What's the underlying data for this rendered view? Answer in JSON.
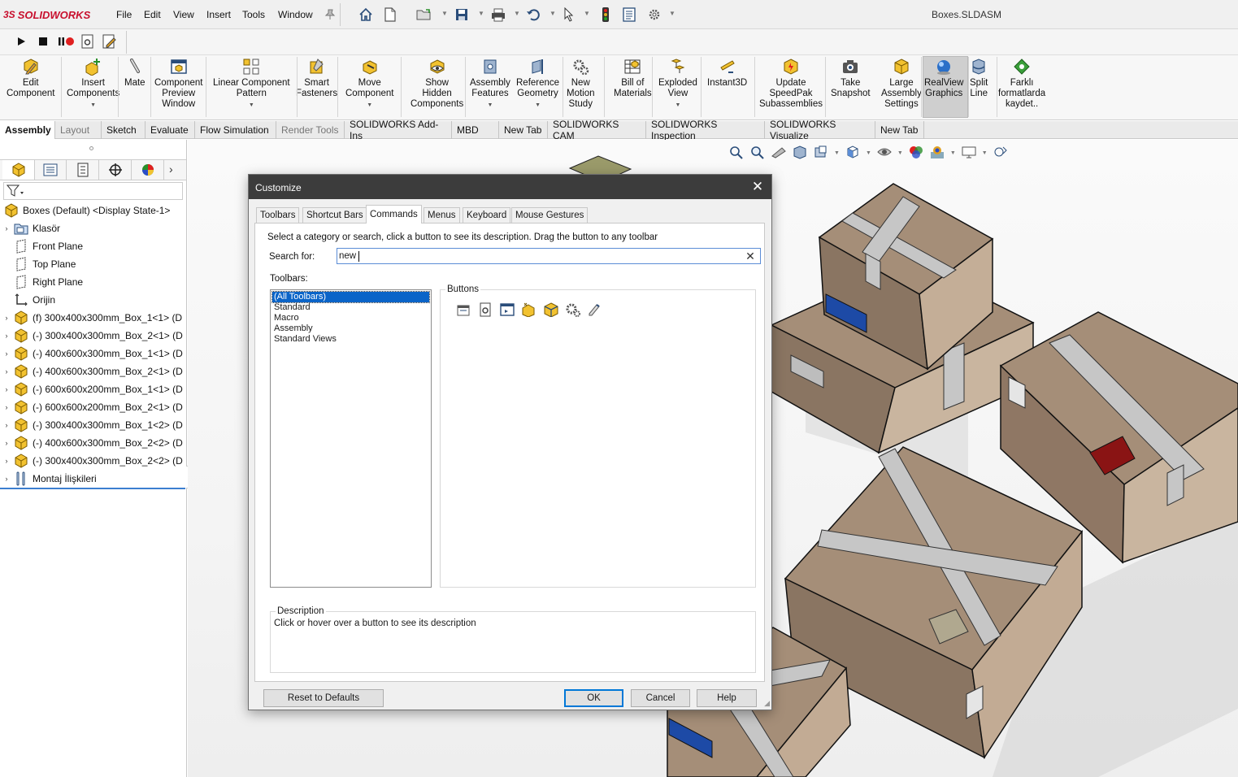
{
  "app": {
    "brand_prefix": "3S",
    "brand_name": "SOLIDWORKS",
    "document_title": "Boxes.SLDASM"
  },
  "menu": [
    "File",
    "Edit",
    "View",
    "Insert",
    "Tools",
    "Window"
  ],
  "ribbon": [
    {
      "label": "Edit\nComponent",
      "icon": "edit-component-icon"
    },
    {
      "label": "Insert\nComponents",
      "icon": "insert-components-icon",
      "dropdown": true
    },
    {
      "label": "Mate",
      "icon": "mate-icon"
    },
    {
      "label": "Component\nPreview\nWindow",
      "icon": "preview-window-icon"
    },
    {
      "label": "Linear Component\nPattern",
      "icon": "linear-pattern-icon",
      "dropdown": true
    },
    {
      "label": "Smart\nFasteners",
      "icon": "smart-fasteners-icon"
    },
    {
      "label": "Move\nComponent",
      "icon": "move-component-icon",
      "dropdown": true
    },
    {
      "label": "Show\nHidden\nComponents",
      "icon": "show-hidden-icon"
    },
    {
      "label": "Assembly\nFeatures",
      "icon": "assembly-features-icon",
      "dropdown": true
    },
    {
      "label": "Reference\nGeometry",
      "icon": "reference-geometry-icon",
      "dropdown": true
    },
    {
      "label": "New\nMotion\nStudy",
      "icon": "motion-study-icon"
    },
    {
      "label": "Bill of\nMaterials",
      "icon": "bom-icon"
    },
    {
      "label": "Exploded\nView",
      "icon": "exploded-view-icon",
      "dropdown": true
    },
    {
      "label": "Instant3D",
      "icon": "instant3d-icon"
    },
    {
      "label": "Update\nSpeedPak\nSubassemblies",
      "icon": "speedpak-icon"
    },
    {
      "label": "Take\nSnapshot",
      "icon": "snapshot-icon"
    },
    {
      "label": "Large\nAssembly\nSettings",
      "icon": "large-assembly-icon"
    },
    {
      "label": "RealView\nGraphics",
      "icon": "realview-icon"
    },
    {
      "label": "Split\nLine",
      "icon": "split-line-icon"
    },
    {
      "label": "Farklı\nformatlarda\nkaydet..",
      "icon": "save-formats-icon"
    }
  ],
  "tabs": [
    "Assembly",
    "Layout",
    "Sketch",
    "Evaluate",
    "Flow Simulation",
    "Render Tools",
    "SOLIDWORKS Add-Ins",
    "MBD",
    "New Tab",
    "SOLIDWORKS CAM",
    "SOLIDWORKS Inspection",
    "SOLIDWORKS Visualize",
    "New Tab"
  ],
  "tree": {
    "root": "Boxes (Default) <Display State-1>",
    "items": [
      {
        "label": "Klasör",
        "icon": "folder-icon",
        "exp": true
      },
      {
        "label": "Front Plane",
        "icon": "plane-icon",
        "exp": false
      },
      {
        "label": "Top Plane",
        "icon": "plane-icon",
        "exp": false
      },
      {
        "label": "Right Plane",
        "icon": "plane-icon",
        "exp": false
      },
      {
        "label": "Orijin",
        "icon": "origin-icon",
        "exp": false
      },
      {
        "label": "(f) 300x400x300mm_Box_1<1> (D",
        "icon": "part-icon",
        "exp": true
      },
      {
        "label": "(-) 300x400x300mm_Box_2<1> (D",
        "icon": "part-icon",
        "exp": true
      },
      {
        "label": "(-) 400x600x300mm_Box_1<1> (D",
        "icon": "part-icon",
        "exp": true
      },
      {
        "label": "(-) 400x600x300mm_Box_2<1> (D",
        "icon": "part-icon",
        "exp": true
      },
      {
        "label": "(-) 600x600x200mm_Box_1<1> (D",
        "icon": "part-icon",
        "exp": true
      },
      {
        "label": "(-) 600x600x200mm_Box_2<1> (D",
        "icon": "part-icon",
        "exp": true
      },
      {
        "label": "(-) 300x400x300mm_Box_1<2> (D",
        "icon": "part-icon",
        "exp": true
      },
      {
        "label": "(-) 400x600x300mm_Box_2<2> (D",
        "icon": "part-icon",
        "exp": true
      },
      {
        "label": "(-) 300x400x300mm_Box_2<2> (D",
        "icon": "part-icon",
        "exp": true
      },
      {
        "label": "Montaj İlişkileri",
        "icon": "mates-folder-icon",
        "exp": true
      }
    ]
  },
  "dialog": {
    "title": "Customize",
    "tabs": [
      "Toolbars",
      "Shortcut Bars",
      "Commands",
      "Menus",
      "Keyboard",
      "Mouse Gestures"
    ],
    "active_tab": "Commands",
    "instructions": "Select a category or search, click a button to see its description. Drag the button to any toolbar",
    "search_label": "Search for:",
    "search_value": "new",
    "toolbars_label": "Toolbars:",
    "toolbars": [
      "(All Toolbars)",
      "Standard",
      "Macro",
      "Assembly",
      "Standard Views"
    ],
    "selected_toolbar": "(All Toolbars)",
    "buttons_label": "Buttons",
    "buttons": [
      "new-window-icon",
      "new-macro-icon",
      "new-drawing-view-icon",
      "new-part-icon",
      "new-assembly-icon",
      "new-motion-study-icon",
      "new-feature-icon"
    ],
    "description_label": "Description",
    "description_text": "Click or hover over a button to see its description",
    "reset_label": "Reset to Defaults",
    "ok_label": "OK",
    "cancel_label": "Cancel",
    "help_label": "Help"
  },
  "colors": {
    "accent": "#0a64c8",
    "brand": "#c8102e",
    "box": "#a58e78",
    "tape": "#c6c6c6"
  }
}
